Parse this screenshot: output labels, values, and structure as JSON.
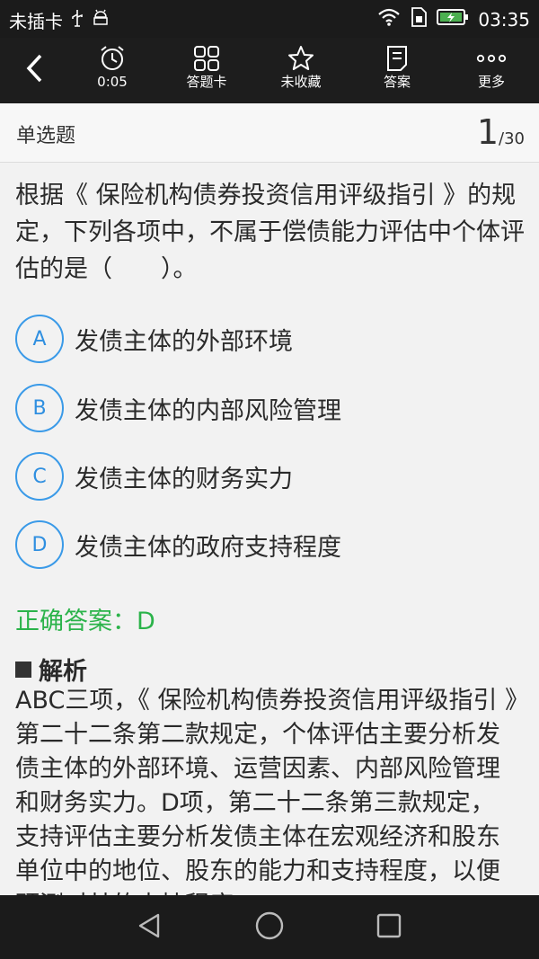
{
  "status_bar": {
    "carrier": "未插卡",
    "time": "03:35"
  },
  "toolbar": {
    "timer_label": "0:05",
    "answer_card_label": "答题卡",
    "favorite_label": "未收藏",
    "answer_label": "答案",
    "more_label": "更多"
  },
  "header": {
    "question_type": "单选题",
    "current": "1",
    "total": "/30"
  },
  "question": {
    "text": "根据《 保险机构债券投资信用评级指引 》的规定，下列各项中，不属于偿债能力评估中个体评估的是（　　）。"
  },
  "options": [
    {
      "letter": "A",
      "text": "发债主体的外部环境"
    },
    {
      "letter": "B",
      "text": "发债主体的内部风险管理"
    },
    {
      "letter": "C",
      "text": "发债主体的财务实力"
    },
    {
      "letter": "D",
      "text": "发债主体的政府支持程度"
    }
  ],
  "answer": {
    "text": "正确答案：D"
  },
  "analysis": {
    "title": "解析",
    "text": "ABC三项，《 保险机构债券投资信用评级指引 》第二十二条第二款规定，个体评估主要分析发债主体的外部环境、运营因素、内部风险管理和财务实力。D项，第二十二条第三款规定，支持评估主要分析发债主体在宏观经济和股东单位中的地位、股东的能力和支持程度，以便预测对其的支持程度。"
  },
  "colors": {
    "accent": "#3a9ae8",
    "correct": "#2bb34a",
    "toolbar_bg": "#1d1d1d"
  }
}
